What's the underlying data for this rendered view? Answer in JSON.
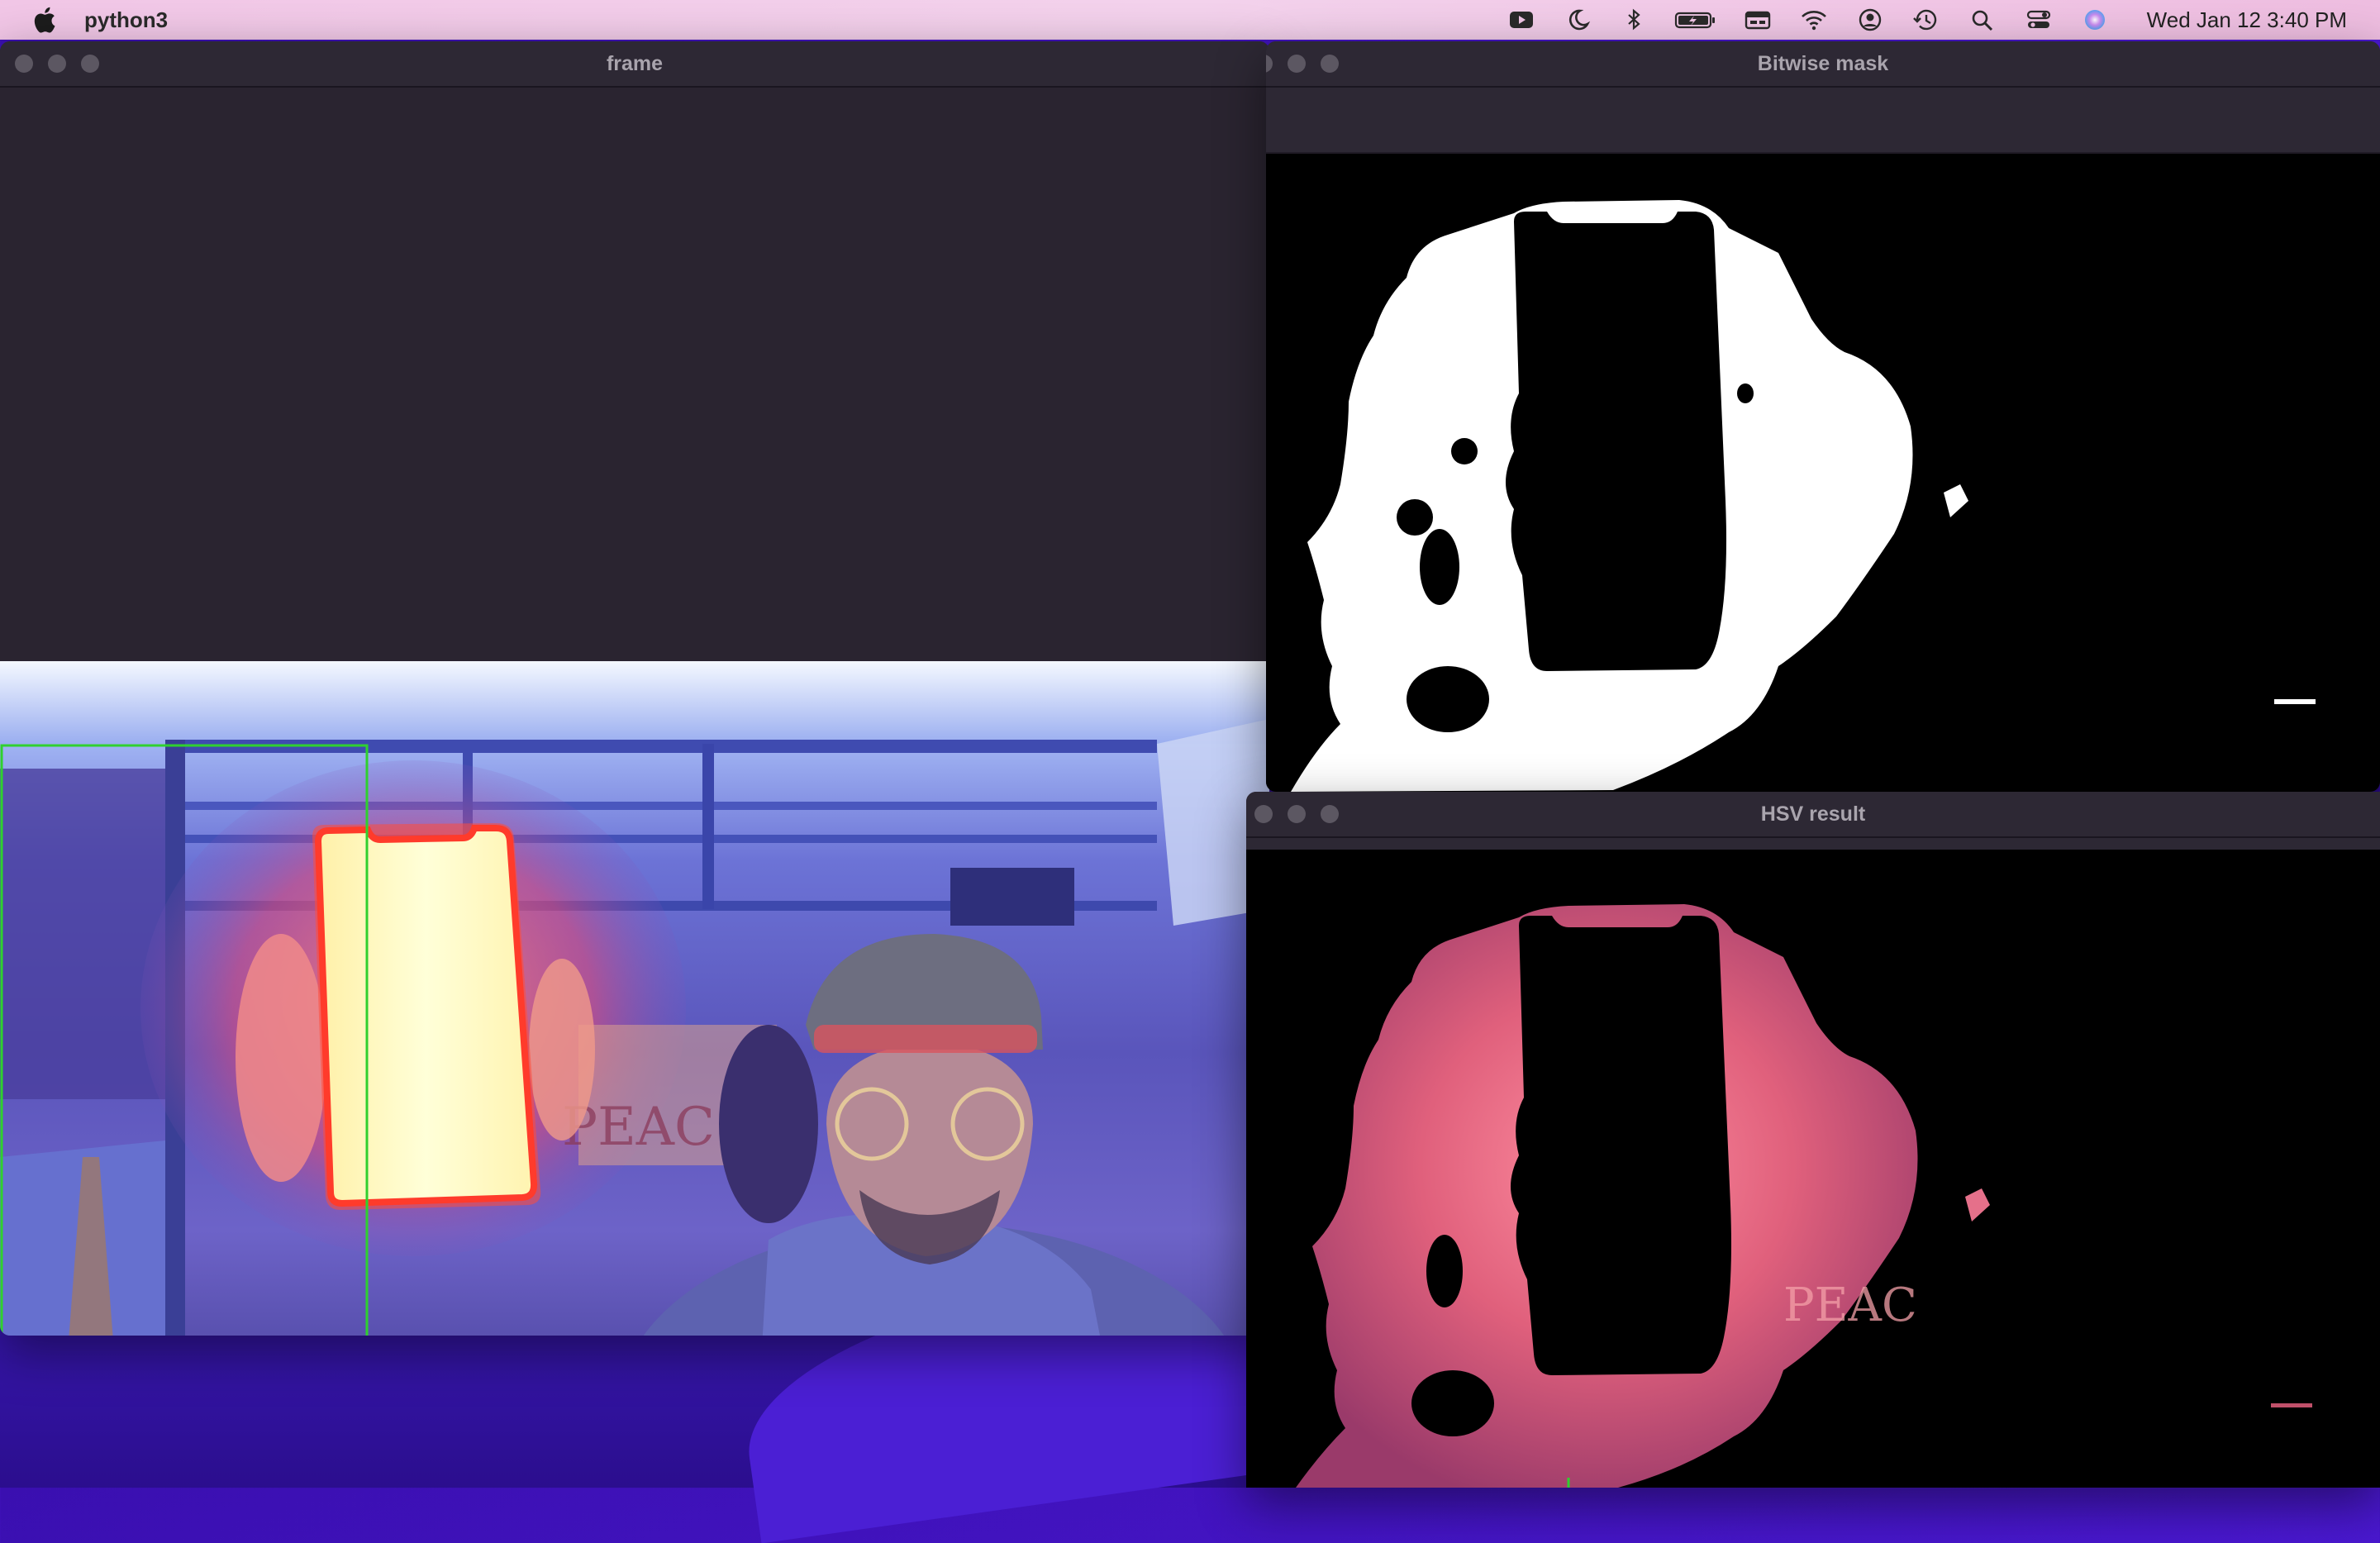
{
  "menubar": {
    "app_name": "python3",
    "clock": "Wed Jan 12  3:40 PM",
    "status_icons": [
      "video-camera-icon",
      "moon-icon",
      "bluetooth-icon",
      "battery-icon",
      "keyboard-icon",
      "wifi-icon",
      "user-icon",
      "time-machine-icon",
      "search-icon",
      "control-center-icon",
      "siri-icon"
    ]
  },
  "windows": {
    "frame": {
      "title": "frame"
    },
    "mask": {
      "title": "Bitwise mask"
    },
    "hsv": {
      "title": "HSV result"
    }
  },
  "colors": {
    "menubar_bg": "#f1c6e6",
    "titlebar_bg": "#2d2834",
    "title_text": "#a9a4ad",
    "detection_box": "#2fd02f",
    "desktop": "#3a0fb0"
  }
}
